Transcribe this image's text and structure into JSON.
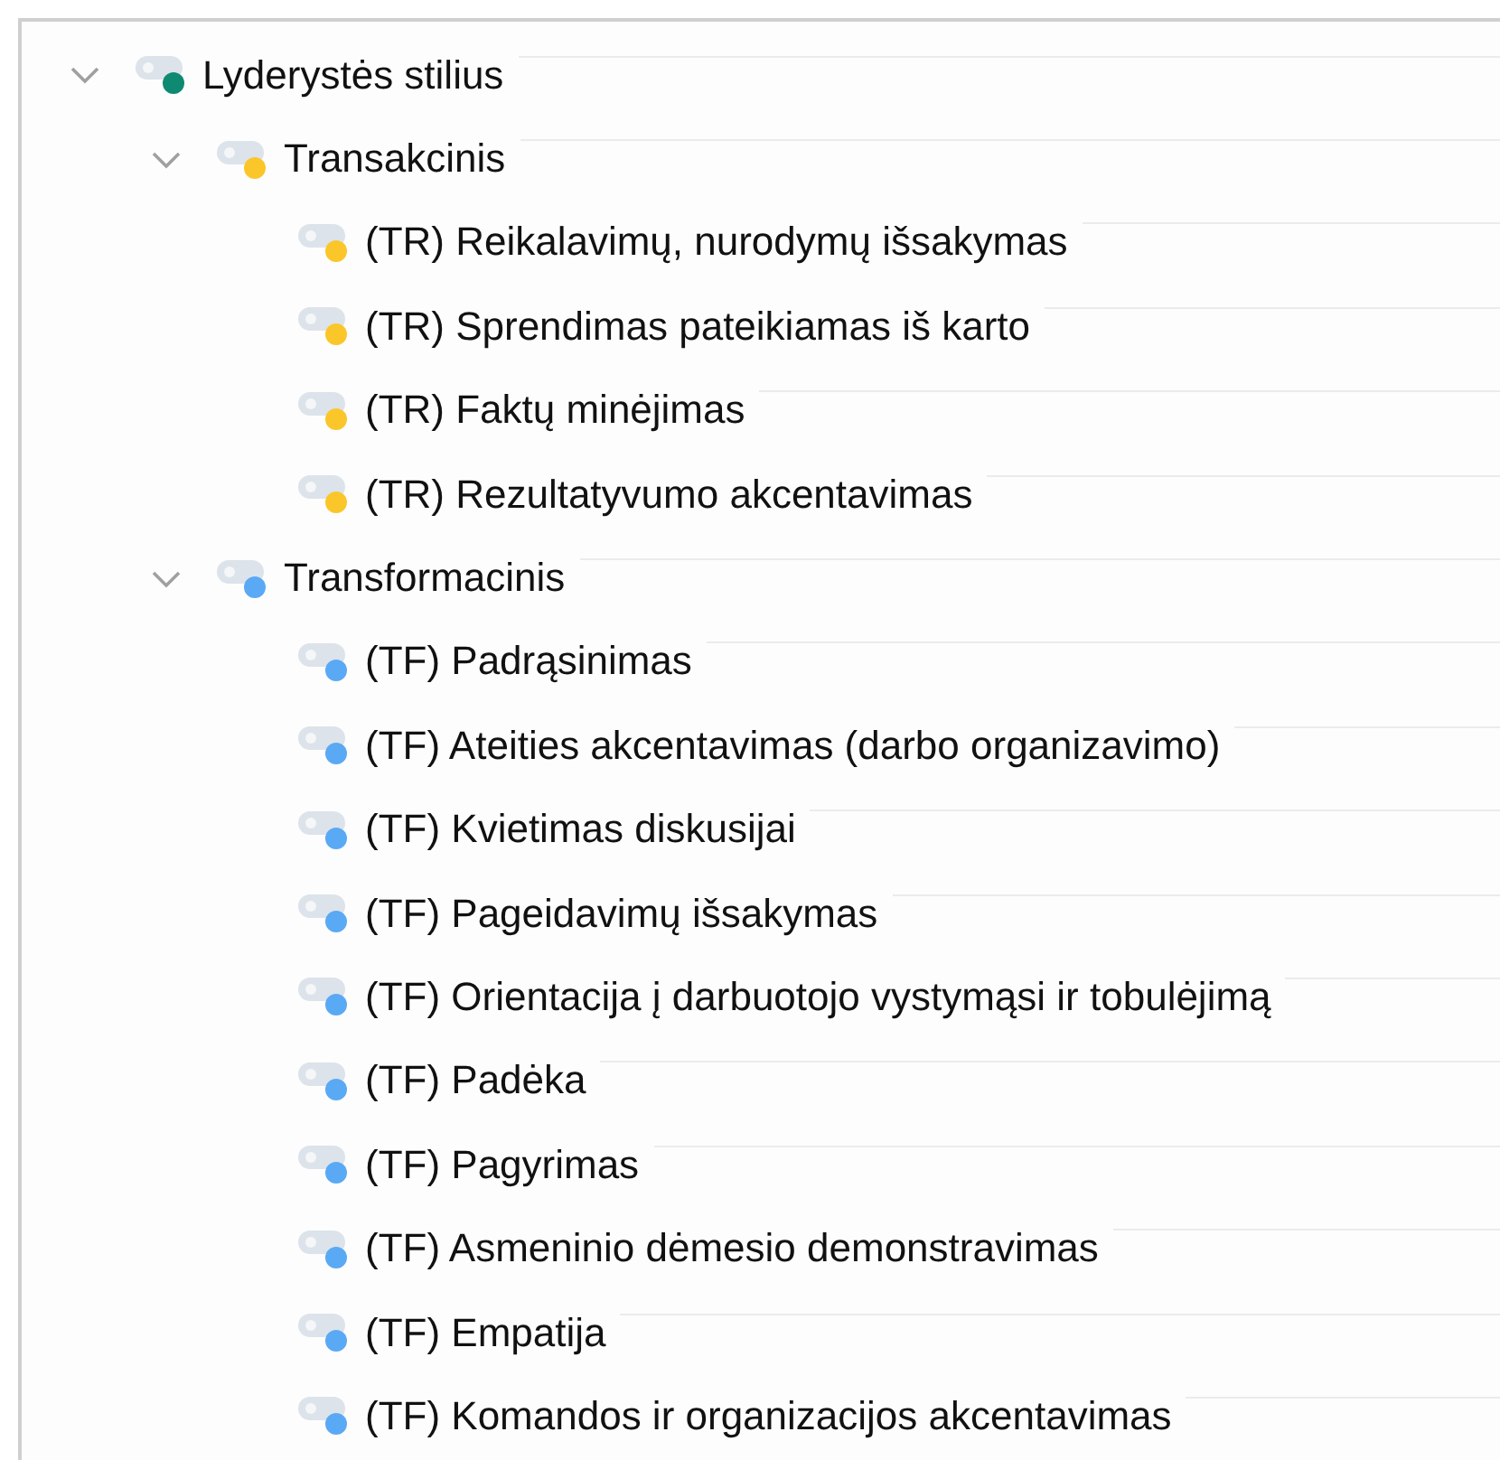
{
  "tree": [
    {
      "label": "Lyderystės stilius",
      "color": "#0f8a72",
      "expanded": true,
      "children": [
        {
          "label": "Transakcinis",
          "color": "#fbc62a",
          "expanded": true,
          "children": [
            {
              "label": "(TR) Reikalavimų, nurodymų išsakymas",
              "color": "#fbc62a"
            },
            {
              "label": "(TR) Sprendimas pateikiamas iš karto",
              "color": "#fbc62a"
            },
            {
              "label": "(TR) Faktų minėjimas",
              "color": "#fbc62a"
            },
            {
              "label": "(TR) Rezultatyvumo akcentavimas",
              "color": "#fbc62a"
            }
          ]
        },
        {
          "label": "Transformacinis",
          "color": "#5aa9f5",
          "expanded": true,
          "children": [
            {
              "label": "(TF) Padrąsinimas",
              "color": "#5aa9f5"
            },
            {
              "label": "(TF) Ateities akcentavimas (darbo organizavimo)",
              "color": "#5aa9f5"
            },
            {
              "label": "(TF) Kvietimas diskusijai",
              "color": "#5aa9f5"
            },
            {
              "label": "(TF) Pageidavimų išsakymas",
              "color": "#5aa9f5"
            },
            {
              "label": "(TF) Orientacija į darbuotojo vystymąsi ir tobulėjimą",
              "color": "#5aa9f5"
            },
            {
              "label": "(TF) Padėka",
              "color": "#5aa9f5"
            },
            {
              "label": "(TF) Pagyrimas",
              "color": "#5aa9f5"
            },
            {
              "label": "(TF) Asmeninio dėmesio demonstravimas",
              "color": "#5aa9f5"
            },
            {
              "label": "(TF) Empatija",
              "color": "#5aa9f5"
            },
            {
              "label": "(TF) Komandos ir organizacijos akcentavimas",
              "color": "#5aa9f5"
            }
          ]
        }
      ]
    }
  ]
}
